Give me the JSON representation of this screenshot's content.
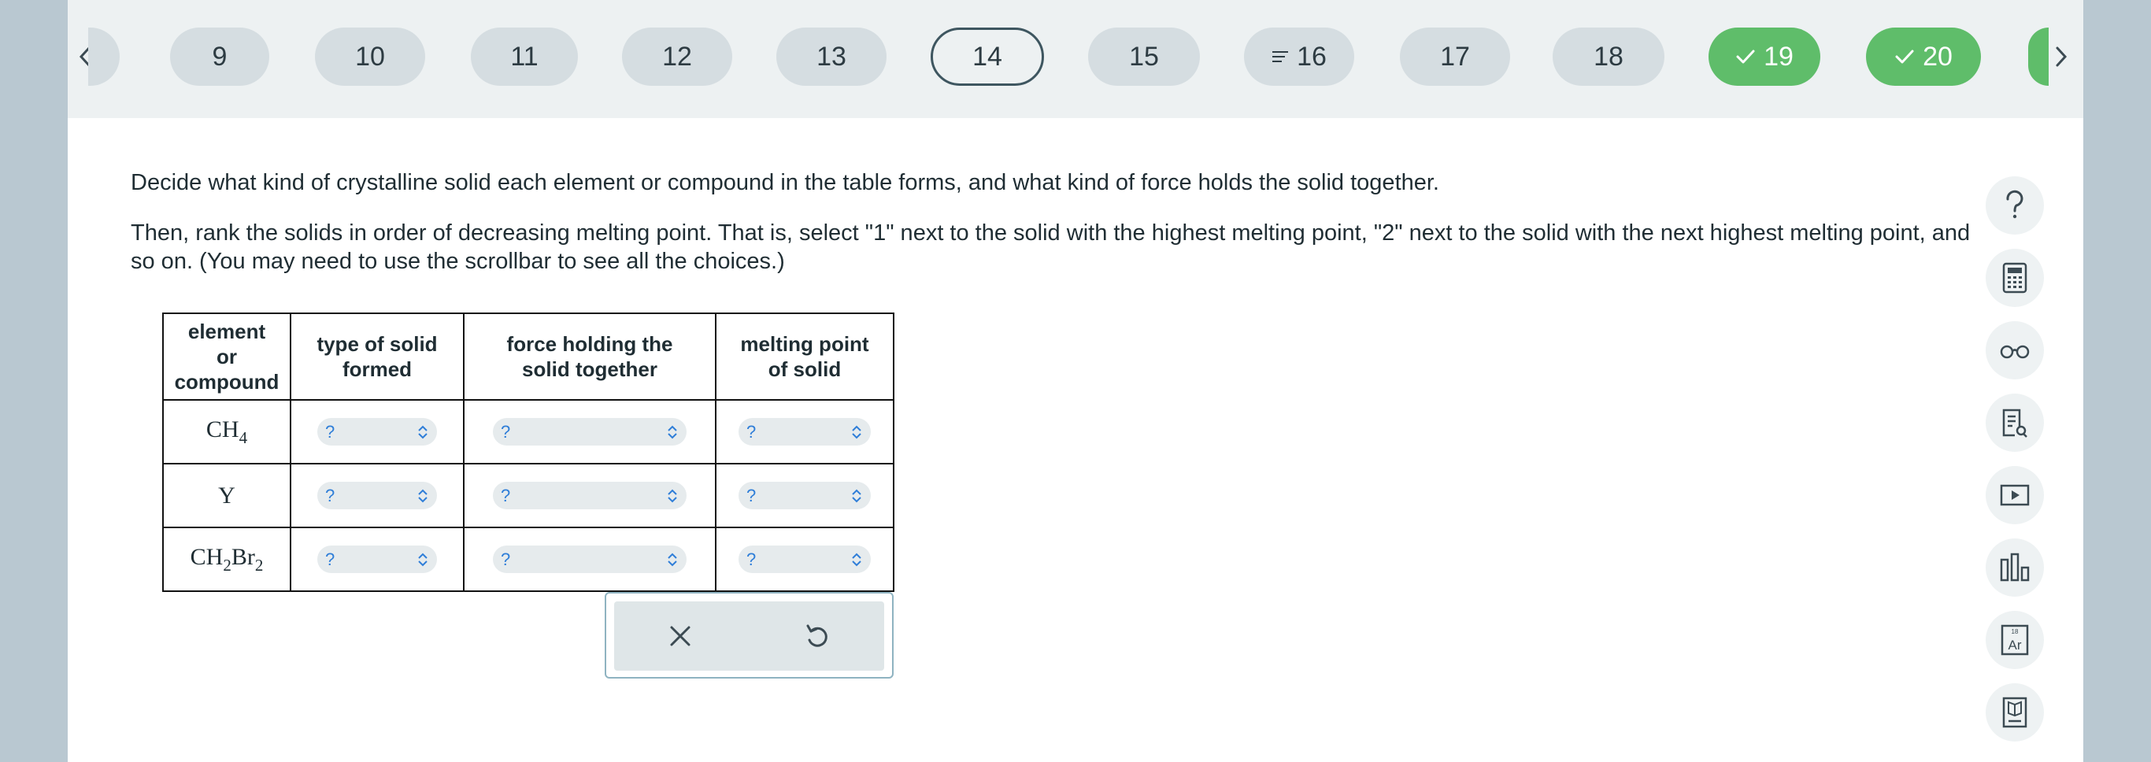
{
  "nav": {
    "questions": [
      {
        "label": "9",
        "state": "default"
      },
      {
        "label": "10",
        "state": "default"
      },
      {
        "label": "11",
        "state": "default"
      },
      {
        "label": "12",
        "state": "default"
      },
      {
        "label": "13",
        "state": "default"
      },
      {
        "label": "14",
        "state": "current"
      },
      {
        "label": "15",
        "state": "default"
      },
      {
        "label": "16",
        "state": "flagged"
      },
      {
        "label": "17",
        "state": "default"
      },
      {
        "label": "18",
        "state": "default"
      },
      {
        "label": "19",
        "state": "done"
      },
      {
        "label": "20",
        "state": "done"
      }
    ],
    "done_color": "#5fbd6a"
  },
  "question": {
    "paragraph1": "Decide what kind of crystalline solid each element or compound in the table forms, and what kind of force holds the solid together.",
    "paragraph2": "Then, rank the solids in order of decreasing melting point. That is, select \"1\" next to the solid with the highest melting point, \"2\" next to the solid with the next highest melting point, and so on. (You may need to use the scrollbar to see all the choices.)"
  },
  "table": {
    "headers": {
      "col1_line1": "element",
      "col1_line2": "or",
      "col1_line3": "compound",
      "col2_line1": "type of solid",
      "col2_line2": "formed",
      "col3_line1": "force holding the",
      "col3_line2": "solid together",
      "col4_line1": "melting point",
      "col4_line2": "of solid"
    },
    "rows": [
      {
        "formula_base": "CH",
        "formula_sub": "4",
        "type": "?",
        "force": "?",
        "melting": "?"
      },
      {
        "formula_base": "Y",
        "type": "?",
        "force": "?",
        "melting": "?"
      },
      {
        "formula_part1": "CH",
        "formula_sub1": "2",
        "formula_part2": "Br",
        "formula_sub2": "2",
        "type": "?",
        "force": "?",
        "melting": "?"
      }
    ]
  },
  "tools": {
    "periodic_table_number": "18",
    "periodic_table_symbol": "Ar"
  }
}
